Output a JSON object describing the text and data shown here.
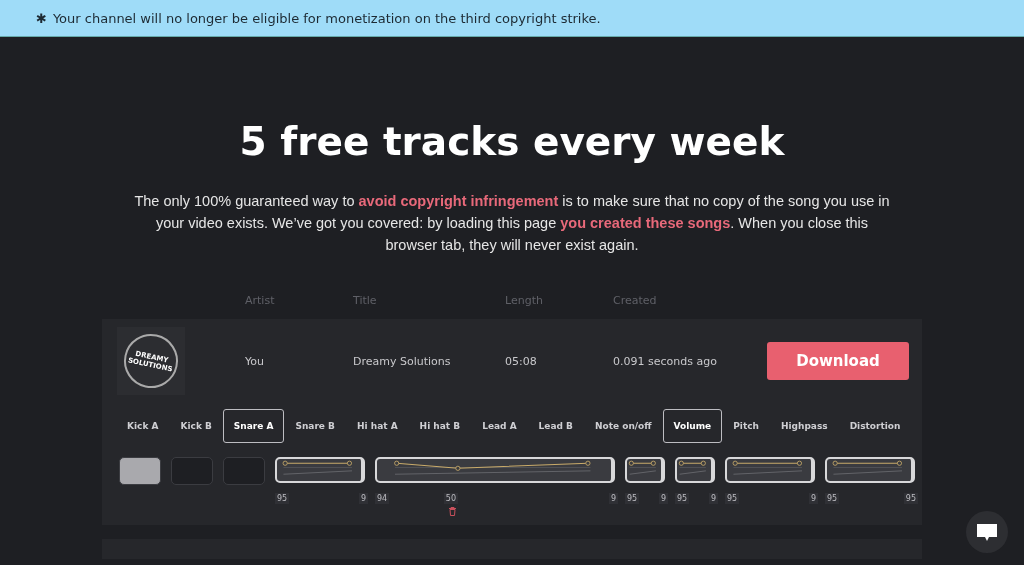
{
  "banner": {
    "mark": "✱",
    "text": "Your channel will no longer be eligible for monetization on the third copyright strike."
  },
  "headline": "5 free tracks every week",
  "intro": "The only 100% guaranteed way to **avoid copyright infringement** is to make sure that no copy of the song you use in your video exists. We’ve got you covered: by loading this page **you created these songs**. When you close this browser tab, they will never exist again.",
  "table": {
    "columns": [
      "Artist",
      "Title",
      "Length",
      "Created"
    ],
    "rows": [
      {
        "cover": {
          "line_1": "DREAMY",
          "line_2": "SOLUTIONS"
        },
        "artist": "You",
        "title": "Dreamy Solutions",
        "length": "05:08",
        "created": "0.091 seconds ago",
        "action": "Download",
        "instruments": [
          {
            "label": "Kick A",
            "selected": false
          },
          {
            "label": "Kick B",
            "selected": false
          },
          {
            "label": "Snare A",
            "selected": true
          },
          {
            "label": "Snare B",
            "selected": false
          },
          {
            "label": "Hi hat A",
            "selected": false
          },
          {
            "label": "Hi hat B",
            "selected": false
          },
          {
            "label": "Lead A",
            "selected": false
          },
          {
            "label": "Lead B",
            "selected": false
          },
          {
            "label": "Note on/off",
            "selected": false
          }
        ],
        "parameters": [
          {
            "label": "Volume",
            "selected": true
          },
          {
            "label": "Pitch",
            "selected": false
          },
          {
            "label": "Highpass",
            "selected": false
          },
          {
            "label": "Distortion",
            "selected": false
          }
        ],
        "sequence": [
          {
            "kind": "pad",
            "filled": true
          },
          {
            "kind": "pad",
            "filled": false
          },
          {
            "kind": "pad",
            "filled": false
          },
          {
            "kind": "clip",
            "points": [
              "95",
              "9"
            ]
          },
          {
            "kind": "clip",
            "points": [
              "94",
              "50",
              "9"
            ]
          },
          {
            "kind": "clip",
            "points": [
              "95",
              "9"
            ]
          },
          {
            "kind": "clip",
            "points": [
              "95",
              "9"
            ]
          },
          {
            "kind": "clip",
            "points": [
              "95",
              "9"
            ]
          },
          {
            "kind": "clip",
            "points": [
              "95",
              "95"
            ]
          }
        ]
      }
    ]
  }
}
